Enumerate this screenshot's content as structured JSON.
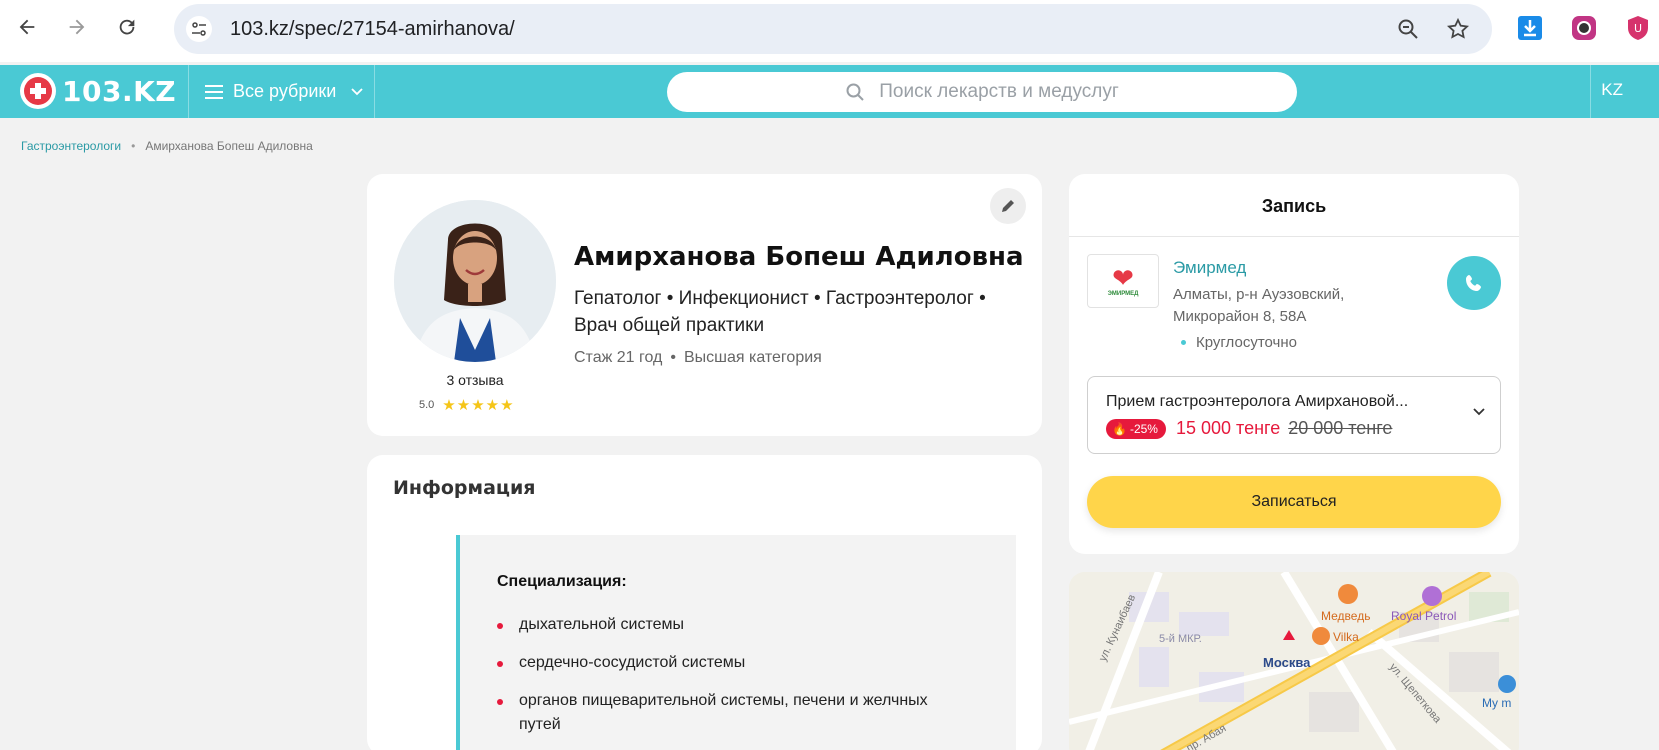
{
  "browser": {
    "url": "103.kz/spec/27154-amirhanova/"
  },
  "header": {
    "logo_text": "103.KZ",
    "rubrics_label": "Все рубрики",
    "search_placeholder": "Поиск лекарств и медуслуг",
    "lang": "KZ",
    "accent_color": "#4ac9d4"
  },
  "breadcrumb": {
    "items": [
      "Гастроэнтерологи",
      "Амирханова Бопеш Адиловна"
    ]
  },
  "profile": {
    "name": "Амирханова Бопеш Адиловна",
    "specialties": "Гепатолог • Инфекционист • Гастроэнтеролог • Врач общей практики",
    "experience": "Стаж 21 год",
    "category": "Высшая категория",
    "reviews": "3 отзыва",
    "rating": "5.0",
    "stars": "★★★★★"
  },
  "info": {
    "title": "Информация",
    "spec_title": "Специализация:",
    "items": [
      "дыхательной системы",
      "сердечно-сосудистой системы",
      "органов пищеварительной системы, печени и желчных путей"
    ]
  },
  "booking": {
    "title": "Запись",
    "clinic_name": "Эмирмед",
    "clinic_logo_text": "ЭМИРМЕД",
    "clinic_address": "Алматы, р-н Ауэзовский, Микрорайон 8, 58А",
    "clinic_hours": "Круглосуточно",
    "service_name": "Прием гастроэнтеролога Амирхановой...",
    "discount": "-25%",
    "price_new": "15 000 тенге",
    "price_old": "20 000 тенге",
    "book_label": "Записаться",
    "discount_color": "#e6193c",
    "button_color": "#ffd54a"
  },
  "map": {
    "labels": {
      "kunay": "ул. Кунаибаев",
      "district": "5-й МКР.",
      "medved": "Медведь",
      "royal": "Royal Petrol",
      "vilka": "Vilka",
      "moskva": "Москва",
      "shchep": "ул. Щепеткова",
      "abaya": "пр. Абая",
      "my": "My m"
    }
  }
}
